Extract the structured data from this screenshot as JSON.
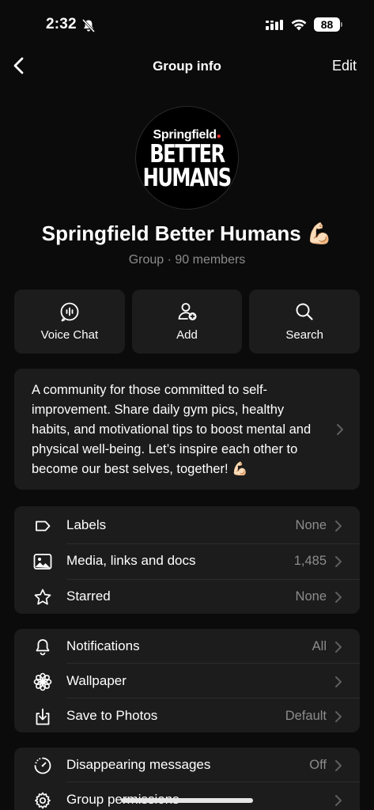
{
  "status_bar": {
    "time": "2:32",
    "battery": "88",
    "icons": [
      "bell-slash-icon",
      "signal-icon",
      "wifi-icon",
      "battery-icon"
    ]
  },
  "nav": {
    "title": "Group info",
    "edit_label": "Edit",
    "back_icon": "chevron-left-icon"
  },
  "group": {
    "avatar": {
      "brand": "Springfield",
      "line1": "BETTER",
      "line2": "HUMANS"
    },
    "name": "Springfield Better Humans 💪🏻",
    "subtitle": "Group · 90 members"
  },
  "actions": [
    {
      "label": "Voice Chat",
      "icon": "voice-chat-icon"
    },
    {
      "label": "Add",
      "icon": "add-person-icon"
    },
    {
      "label": "Search",
      "icon": "search-icon"
    }
  ],
  "description": "A community for those committed to self-improvement. Share daily gym pics, healthy habits, and motivational tips to boost mental and physical well-being. Let’s inspire each other to become our best selves, together! 💪🏻",
  "section1": [
    {
      "label": "Labels",
      "value": "None",
      "icon": "label-tag-icon"
    },
    {
      "label": "Media, links and docs",
      "value": "1,485",
      "icon": "photo-icon"
    },
    {
      "label": "Starred",
      "value": "None",
      "icon": "star-icon"
    }
  ],
  "section2": [
    {
      "label": "Notifications",
      "value": "All",
      "icon": "bell-icon"
    },
    {
      "label": "Wallpaper",
      "value": "",
      "icon": "wallpaper-flower-icon"
    },
    {
      "label": "Save to Photos",
      "value": "Default",
      "icon": "save-download-icon"
    }
  ],
  "section3": [
    {
      "label": "Disappearing messages",
      "value": "Off",
      "icon": "timer-icon"
    },
    {
      "label": "Group permissions",
      "value": "",
      "icon": "gear-icon"
    }
  ]
}
